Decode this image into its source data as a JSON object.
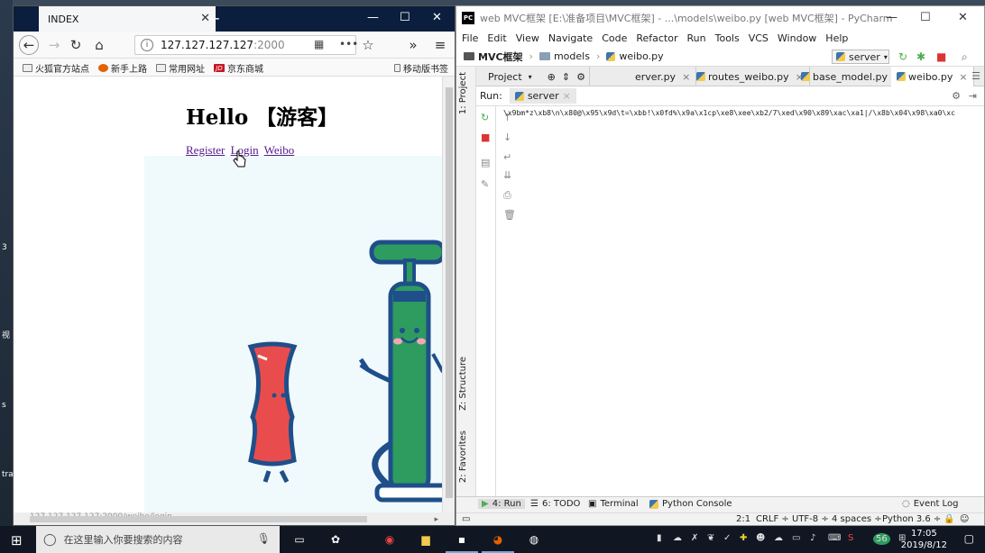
{
  "desktop": {
    "snippets": [
      "3",
      "视",
      "s",
      "tra"
    ]
  },
  "browser": {
    "tab_title": "INDEX",
    "tab_close": "✕",
    "new_tab": "+",
    "win_controls": [
      "—",
      "☐",
      "✕"
    ],
    "url_host": "127.127.127.127",
    "url_port": ":2000",
    "url_info": "i",
    "bookmarks": [
      "火狐官方站点",
      "新手上路",
      "常用网址",
      "京东商城"
    ],
    "mobile_bookmarks": "移动版书签",
    "jd_badge": "JD",
    "page": {
      "heading": "Hello 【游客】",
      "links": [
        "Register",
        "Login",
        "Weibo"
      ]
    },
    "status_text": "127.127.127.127:2000/weibo/login..."
  },
  "pycharm": {
    "logo": "PC",
    "title": "web MVC框架 [E:\\准备项目\\MVC框架] - ...\\models\\weibo.py [web MVC框架] - PyCharm",
    "win_controls": [
      "—",
      "☐",
      "✕"
    ],
    "menu": [
      "File",
      "Edit",
      "View",
      "Navigate",
      "Code",
      "Refactor",
      "Run",
      "Tools",
      "VCS",
      "Window",
      "Help"
    ],
    "breadcrumb": [
      "MVC框架",
      "models",
      "weibo.py"
    ],
    "run_config": "server",
    "left_tools": [
      "1: Project",
      "Z: Structure",
      "2: Favorites"
    ],
    "project_tab": "Project",
    "editor_tabs": [
      "erver.py",
      "routes_weibo.py",
      "base_model.py",
      "weibo.py"
    ],
    "run_label": "Run:",
    "run_tab": "server",
    "console_line": "\\x9bm*z\\xb8\\n\\x80@\\x95\\x9d\\t=\\xbb!\\x0fd%\\x9a\\x1cp\\xe8\\xee\\xb2/7\\xed\\x90\\x89\\xac\\xa1|/\\x8b\\x04\\x98\\xa0\\xc",
    "bottom_tabs": [
      "4: Run",
      "6: TODO",
      "Terminal",
      "Python Console"
    ],
    "event_log": "Event Log",
    "status": {
      "position": "2:1",
      "line_sep": "CRLF ÷",
      "encoding": "UTF-8 ÷",
      "indent": "4 spaces ÷",
      "interpreter": "Python 3.6 ÷"
    }
  },
  "taskbar": {
    "search_placeholder": "在这里输入你要搜索的内容",
    "time": "17:05",
    "date": "2019/8/12",
    "tray_badge": "56"
  }
}
